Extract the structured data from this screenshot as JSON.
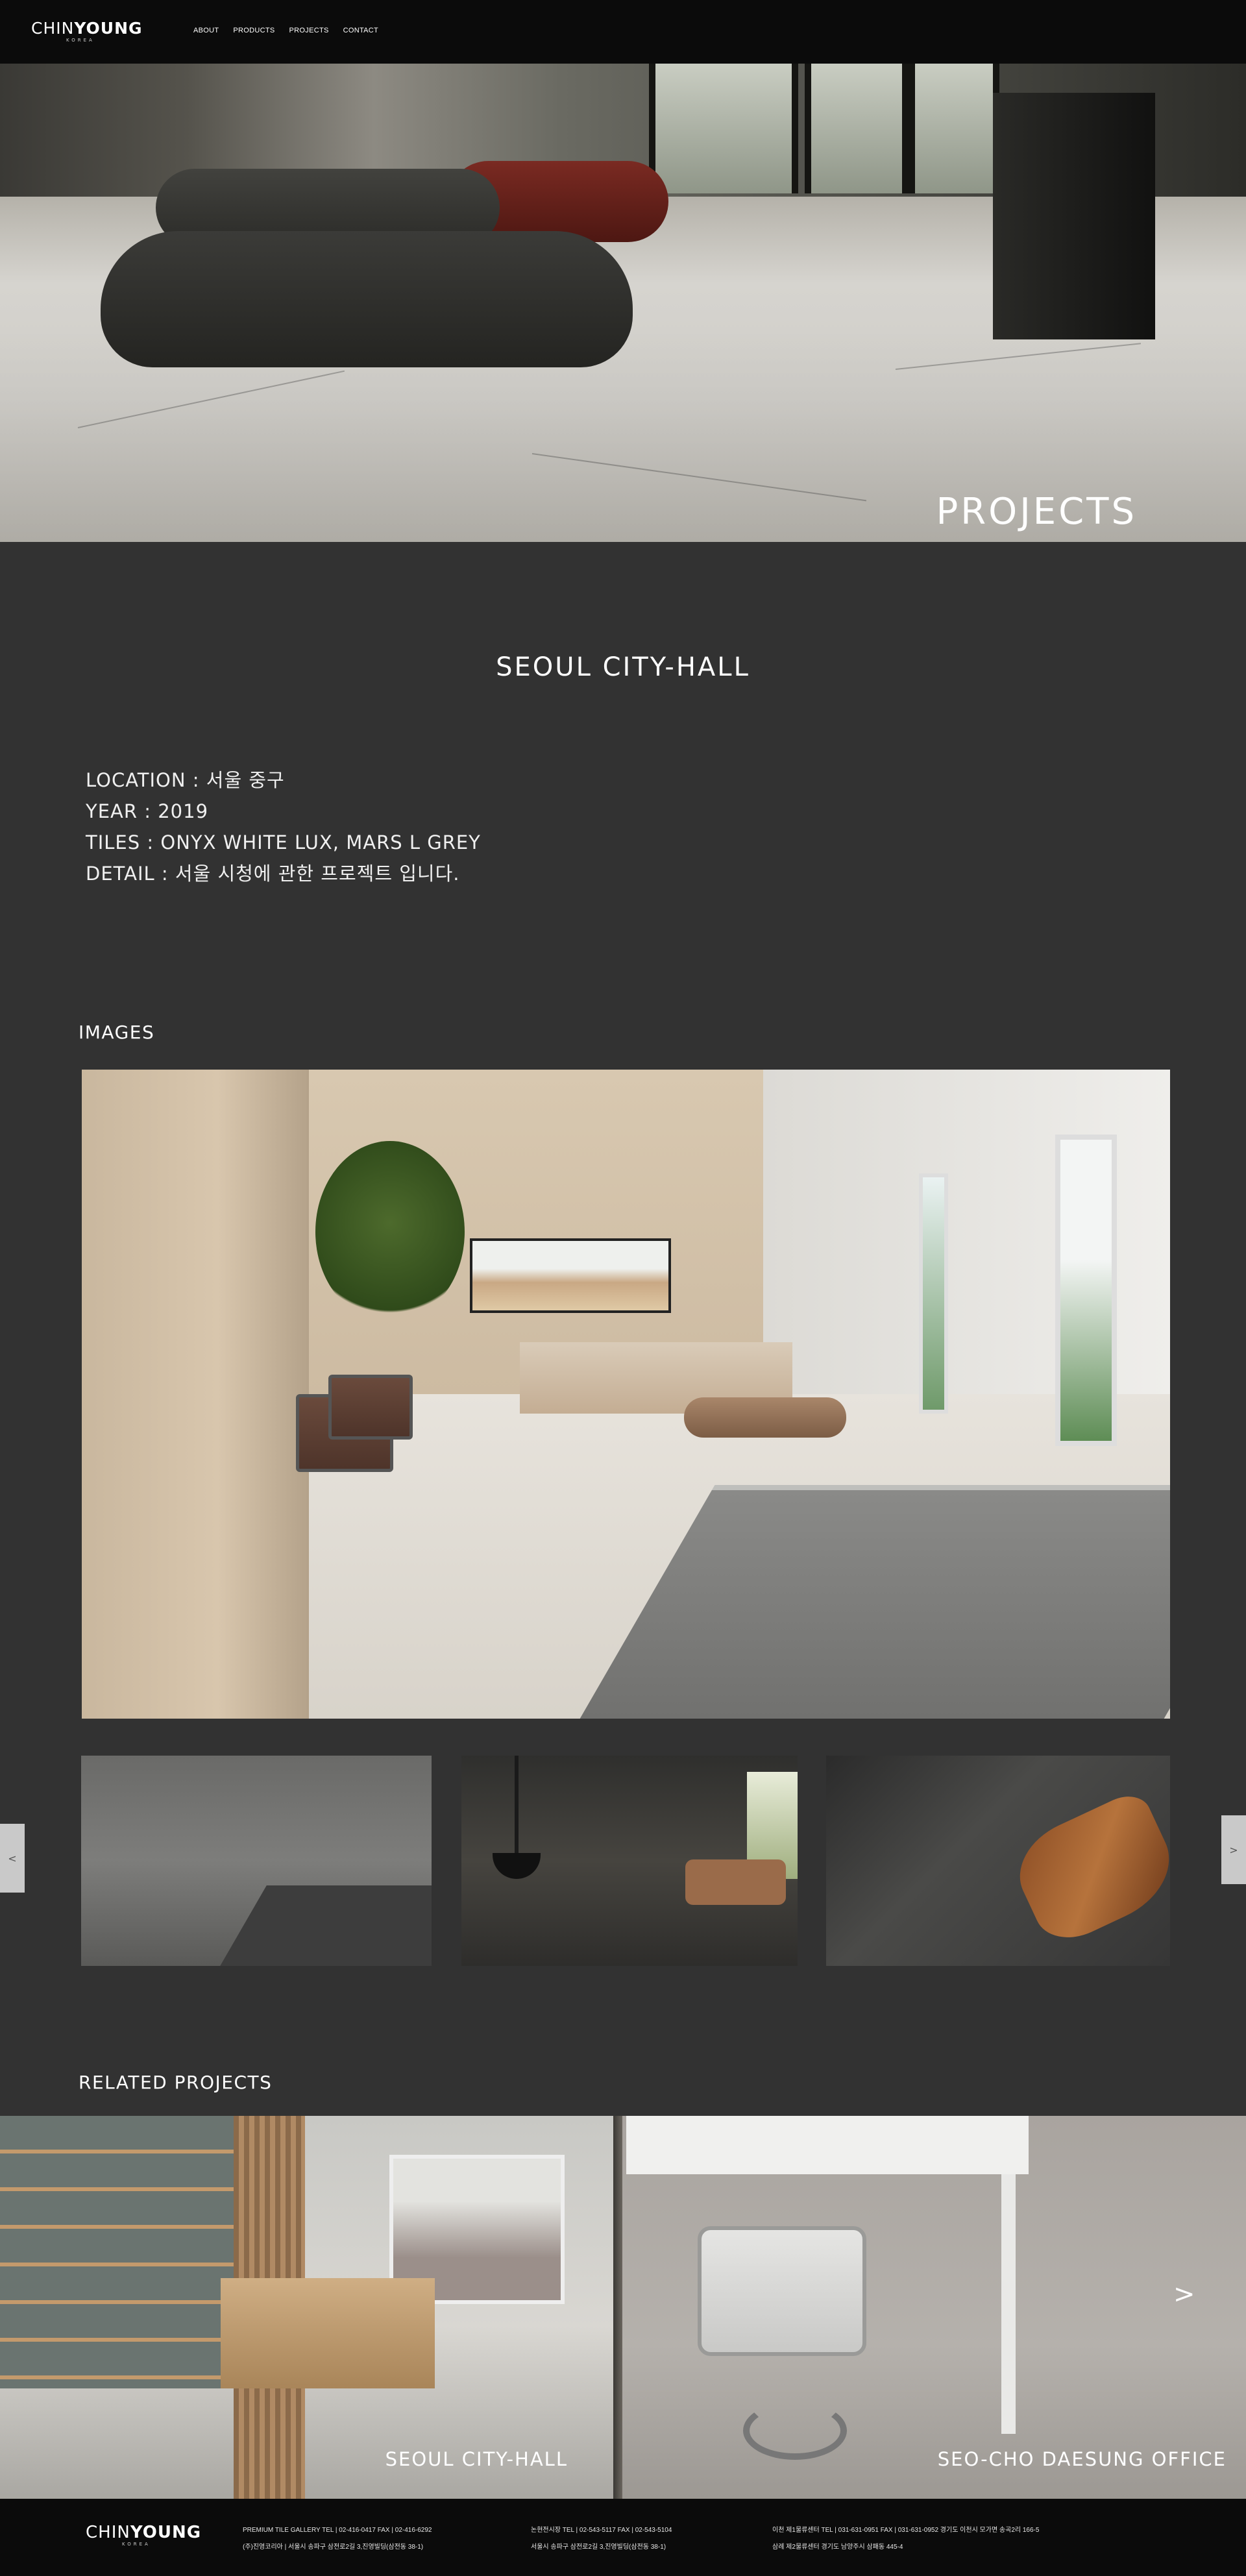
{
  "header": {
    "logo_main_a": "CHIN",
    "logo_main_b": "YOUNG",
    "logo_sub": "KOREA",
    "nav": [
      "ABOUT",
      "PRODUCTS",
      "PROJECTS",
      "CONTACT"
    ]
  },
  "hero": {
    "title": "PROJECTS"
  },
  "project": {
    "title": "SEOUL CITY-HALL",
    "location": "LOCATION : 서울 중구",
    "year": "YEAR : 2019",
    "tiles": "TILES : ONYX WHITE LUX, MARS L GREY",
    "detail": "DETAIL : 서울 시청에 관한 프로젝트 입니다."
  },
  "images": {
    "label": "IMAGES",
    "prev": "<",
    "next": ">"
  },
  "related": {
    "label": "RELATED PROJECTS",
    "items": [
      "SEOUL CITY-HALL",
      "SEO-CHO DAESUNG OFFICE"
    ],
    "next": ">"
  },
  "footer": {
    "logo_main_a": "CHIN",
    "logo_main_b": "YOUNG",
    "logo_sub": "KOREA",
    "col1_line1": "PREMIUM TILE GALLERY     TEL | 02-416-0417     FAX | 02-416-6292",
    "col1_line2": "(주)진영코리아 | 서울시 송파구 삼전로2길 3,진영빌딩(삼전동 38-1)",
    "col2_line1": "논현전시장     TEL | 02-543-5117     FAX | 02-543-5104",
    "col2_line2": "서울시 송파구 삼전로2길 3,진영빌딩(삼전동 38-1)",
    "col3_line1": "이천 제1물류센터     TEL | 031-631-0951     FAX | 031-631-0952     경기도 이천시 모가면 송곡2리 166-5",
    "col3_line2": "삼례 제2물류센터     경기도 남양주시 삼패동 445-4"
  }
}
